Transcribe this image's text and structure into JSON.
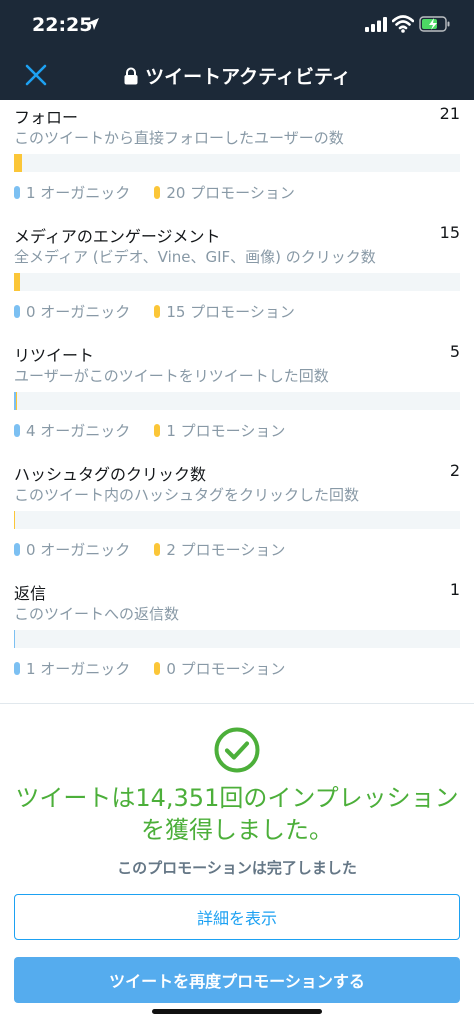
{
  "status_bar": {
    "time": "22:25"
  },
  "header": {
    "title": "ツイートアクティビティ"
  },
  "metrics": [
    {
      "name": "フォロー",
      "count": "21",
      "description": "このツイートから直接フォローしたユーザーの数",
      "organic": 1,
      "promoted": 20,
      "organic_label": "1 オーガニック",
      "promoted_label": "20 プロモーション"
    },
    {
      "name": "メディアのエンゲージメント",
      "count": "15",
      "description": "全メディア (ビデオ、Vine、GIF、画像) のクリック数",
      "organic": 0,
      "promoted": 15,
      "organic_label": "0 オーガニック",
      "promoted_label": "15 プロモーション"
    },
    {
      "name": "リツイート",
      "count": "5",
      "description": "ユーザーがこのツイートをリツイートした回数",
      "organic": 4,
      "promoted": 1,
      "organic_label": "4 オーガニック",
      "promoted_label": "1 プロモーション"
    },
    {
      "name": "ハッシュタグのクリック数",
      "count": "2",
      "description": "このツイート内のハッシュタグをクリックした回数",
      "organic": 0,
      "promoted": 2,
      "organic_label": "0 オーガニック",
      "promoted_label": "2 プロモーション"
    },
    {
      "name": "返信",
      "count": "1",
      "description": "このツイートへの返信数",
      "organic": 1,
      "promoted": 0,
      "organic_label": "1 オーガニック",
      "promoted_label": "0 プロモーション"
    }
  ],
  "summary": {
    "line1": "ツイートは14,351回のインプレッション",
    "line2": "を獲得しました。",
    "complete": "このプロモーションは完了しました"
  },
  "buttons": {
    "details": "詳細を表示",
    "repromote": "ツイートを再度プロモーションする"
  },
  "colors": {
    "header_bg": "#1c2938",
    "organic": "#7cc0f2",
    "promoted": "#fbc638",
    "success": "#4caf3a",
    "accent": "#1da1f2"
  }
}
